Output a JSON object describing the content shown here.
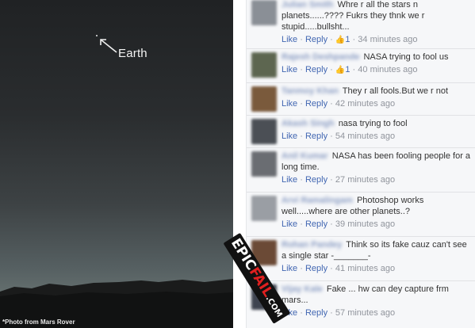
{
  "photo": {
    "label": "Earth",
    "caption": "*Photo from Mars Rover"
  },
  "watermark": {
    "word1": "EPIC",
    "word2": "FAIL",
    "domain": ".COM"
  },
  "actions": {
    "like": "Like",
    "reply": "Reply",
    "separator": "·"
  },
  "comments": [
    {
      "author": "Julian Smith",
      "text": "Whre r all the stars n planets......???? Fukrs they thnk we r stupid.....bullsht...",
      "likes": "1",
      "time": "34 minutes ago",
      "avatar_color": "#8a8f96"
    },
    {
      "author": "Rajesh Deshpande",
      "text": "NASA trying to fool us",
      "likes": "1",
      "time": "40 minutes ago",
      "avatar_color": "#5d6650"
    },
    {
      "author": "Tanmoy Khan",
      "text": "They r all fools.But we r not",
      "time": "42 minutes ago",
      "avatar_color": "#7a5a3c"
    },
    {
      "author": "Akash Singh",
      "text": "nasa trying to fool",
      "time": "54 minutes ago",
      "avatar_color": "#4b4f55"
    },
    {
      "author": "Anil Kumar",
      "text": "NASA has been fooling people for a long time.",
      "time": "27 minutes ago",
      "avatar_color": "#6a6d72"
    },
    {
      "author": "Arvi Ramalingam",
      "text": "Photoshop works well.....where are other planets..?",
      "time": "39 minutes ago",
      "avatar_color": "#9a9ea4"
    },
    {
      "author": "Rohan Pandey",
      "text": "Think so its fake cauz can't see a single star -_______-",
      "time": "41 minutes ago",
      "avatar_color": "#6b4a36"
    },
    {
      "author": "Vijay Kale",
      "text": "Fake ... hw can dey capture frm mars...",
      "time": "57 minutes ago",
      "avatar_color": "#3f4450"
    }
  ]
}
